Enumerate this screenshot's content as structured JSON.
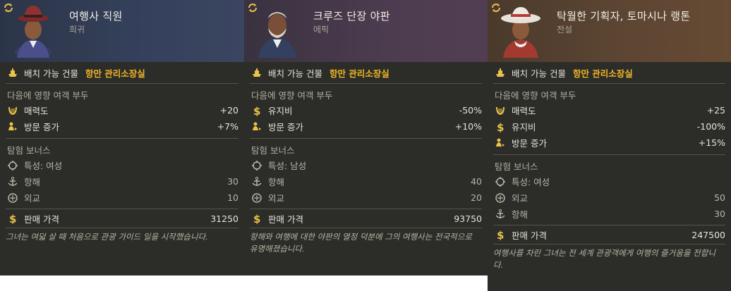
{
  "cards": [
    {
      "name": "여행사 직원",
      "rarity": "희귀",
      "header_color": "#2f3c55",
      "placeable_label": "배치 가능 건물",
      "placeable_value": "항만 관리소장실",
      "affects_title": "다음에 영향 여객 부두",
      "affects": [
        {
          "icon": "lyre-icon",
          "label": "매력도",
          "value": "+20"
        },
        {
          "icon": "visitors-icon",
          "label": "방문 증가",
          "value": "+7%"
        }
      ],
      "expedition_title": "탐험 보너스",
      "expedition": [
        {
          "icon": "gender-icon",
          "label": "특성:  여성",
          "value": ""
        },
        {
          "icon": "anchor-icon",
          "label": "항해",
          "value": "30"
        },
        {
          "icon": "diplomacy-icon",
          "label": "외교",
          "value": "10"
        }
      ],
      "price_label": "판매 가격",
      "price_value": "31250",
      "description": "그녀는 여덟 살 때 처음으로 관광 가이드 일을 시작했습니다."
    },
    {
      "name": "크루즈 단장 야판",
      "rarity": "에픽",
      "header_color": "#4a3a4b",
      "placeable_label": "배치 가능 건물",
      "placeable_value": "항만 관리소장실",
      "affects_title": "다음에 영향 여객 부두",
      "affects": [
        {
          "icon": "dollar-icon",
          "label": "유지비",
          "value": "-50%"
        },
        {
          "icon": "visitors-icon",
          "label": "방문 증가",
          "value": "+10%"
        }
      ],
      "expedition_title": "탐험 보너스",
      "expedition": [
        {
          "icon": "gender-icon",
          "label": "특성:  남성",
          "value": ""
        },
        {
          "icon": "anchor-icon",
          "label": "항해",
          "value": "40"
        },
        {
          "icon": "diplomacy-icon",
          "label": "외교",
          "value": "20"
        }
      ],
      "price_label": "판매 가격",
      "price_value": "93750",
      "description": "항해와 여행에 대한 야판의 열정 덕분에 그의 여행사는 전국적으로 유명해졌습니다."
    },
    {
      "name": "탁월한 기획자, 토마시나 랭톤",
      "rarity": "전설",
      "header_color": "#5a4530",
      "placeable_label": "배치 가능 건물",
      "placeable_value": "항만 관리소장실",
      "affects_title": "다음에 영향 여객 부두",
      "affects": [
        {
          "icon": "lyre-icon",
          "label": "매력도",
          "value": "+25"
        },
        {
          "icon": "dollar-icon",
          "label": "유지비",
          "value": "-100%"
        },
        {
          "icon": "visitors-icon",
          "label": "방문 증가",
          "value": "+15%"
        }
      ],
      "expedition_title": "탐험 보너스",
      "expedition": [
        {
          "icon": "gender-icon",
          "label": "특성:  여성",
          "value": ""
        },
        {
          "icon": "diplomacy-icon",
          "label": "외교",
          "value": "50"
        },
        {
          "icon": "anchor-icon",
          "label": "항해",
          "value": "30"
        }
      ],
      "price_label": "판매 가격",
      "price_value": "247500",
      "description": "여행사를 차린 그녀는 전 세계 관광객에게 여행의 즐거움을 전합니다."
    }
  ]
}
